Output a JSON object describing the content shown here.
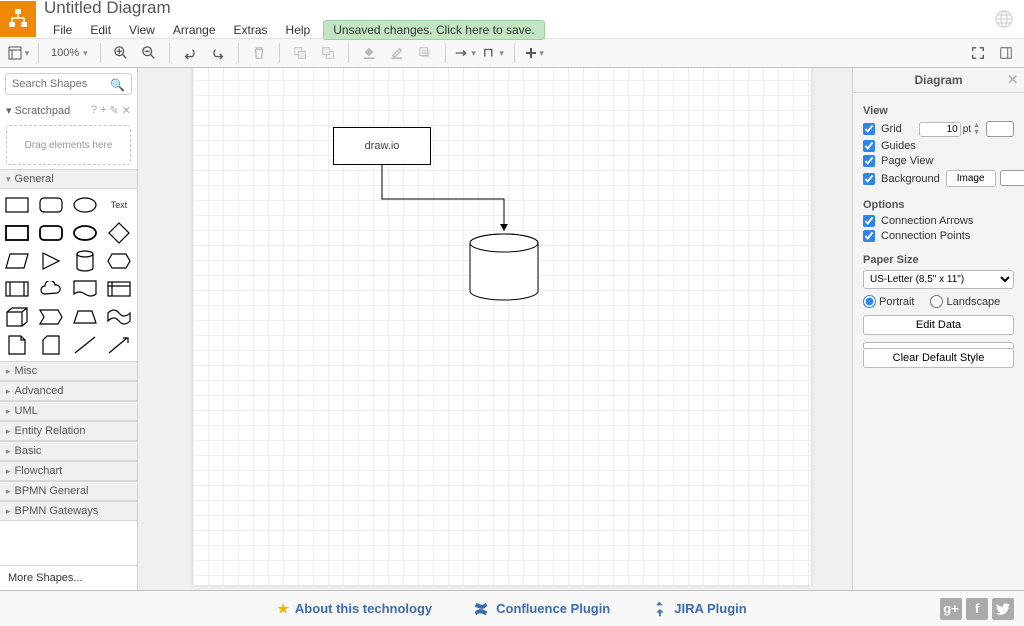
{
  "header": {
    "title": "Untitled Diagram",
    "menu": [
      "File",
      "Edit",
      "View",
      "Arrange",
      "Extras",
      "Help"
    ],
    "save_banner": "Unsaved changes. Click here to save."
  },
  "toolbar": {
    "zoom_level": "100%"
  },
  "left": {
    "search_placeholder": "Search Shapes",
    "scratchpad_title": "Scratchpad",
    "scratchpad_hint": "Drag elements here",
    "sections": {
      "general": "General",
      "misc": "Misc",
      "advanced": "Advanced",
      "uml": "UML",
      "entity": "Entity Relation",
      "basic": "Basic",
      "flowchart": "Flowchart",
      "bpmn_general": "BPMN General",
      "bpmn_gateways": "BPMN Gateways"
    },
    "text_shape_label": "Text",
    "more_shapes": "More Shapes..."
  },
  "canvas": {
    "node_label": "draw.io"
  },
  "right": {
    "panel_title": "Diagram",
    "view_title": "View",
    "grid_label": "Grid",
    "grid_value": "10",
    "grid_unit": "pt",
    "guides_label": "Guides",
    "pageview_label": "Page View",
    "background_label": "Background",
    "image_btn": "Image",
    "options_title": "Options",
    "conn_arrows": "Connection Arrows",
    "conn_points": "Connection Points",
    "papersize_title": "Paper Size",
    "papersize_value": "US-Letter (8,5\" x 11\")",
    "portrait": "Portrait",
    "landscape": "Landscape",
    "edit_data": "Edit Data",
    "clear_style": "Clear Default Style"
  },
  "footer": {
    "about": "About this technology",
    "confluence": "Confluence Plugin",
    "jira": "JIRA Plugin"
  }
}
